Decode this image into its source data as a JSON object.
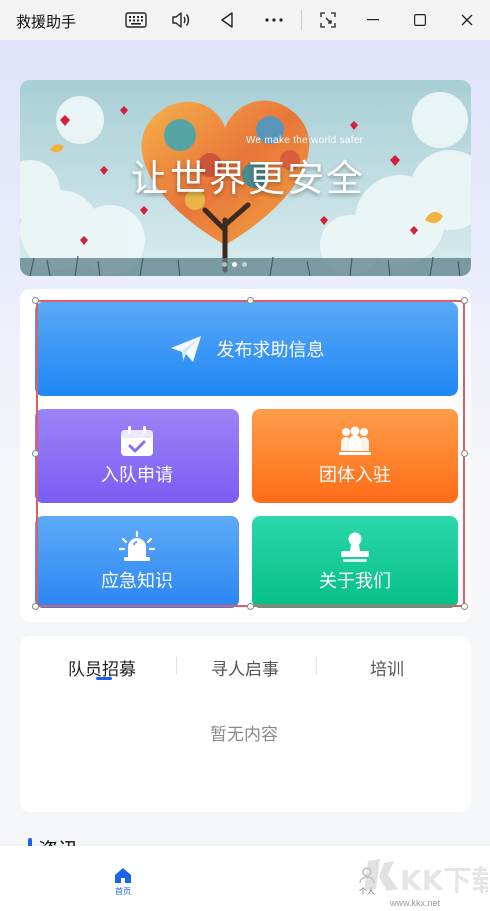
{
  "window": {
    "title": "救援助手",
    "controls": {
      "keyboard": "keyboard-icon",
      "volume": "volume-icon",
      "back": "back-triangle-icon",
      "more": "more-icon",
      "screenshot": "screenshot-icon",
      "minimize": "minimize-icon",
      "maximize": "maximize-icon",
      "close": "close-icon"
    }
  },
  "banner": {
    "slogan": "让世界更安全",
    "slogan_en": "We make the world safer",
    "slide_count": 3,
    "active_slide": 2
  },
  "actions": {
    "publish_help": "发布求助信息",
    "join_team": "入队申请",
    "group_join": "团体入驻",
    "emergency_knowledge": "应急知识",
    "about_us": "关于我们"
  },
  "tabs": {
    "items": [
      "队员招募",
      "寻人启事",
      "培训"
    ],
    "active_index": 0,
    "empty_text": "暂无内容"
  },
  "news": {
    "heading": "资讯"
  },
  "bottom_nav": {
    "home": "首页",
    "me": "个人"
  },
  "watermark": {
    "brand": "KK下载",
    "url": "www.kkx.net"
  },
  "colors": {
    "accent": "#1b64ea",
    "help_btn": "#1f87f4",
    "join_btn": "#7a5df2",
    "group_btn": "#ff6c17",
    "knowledge_btn": "#2a86f2",
    "about_btn": "#06bf86",
    "selection": "#e05c66"
  }
}
